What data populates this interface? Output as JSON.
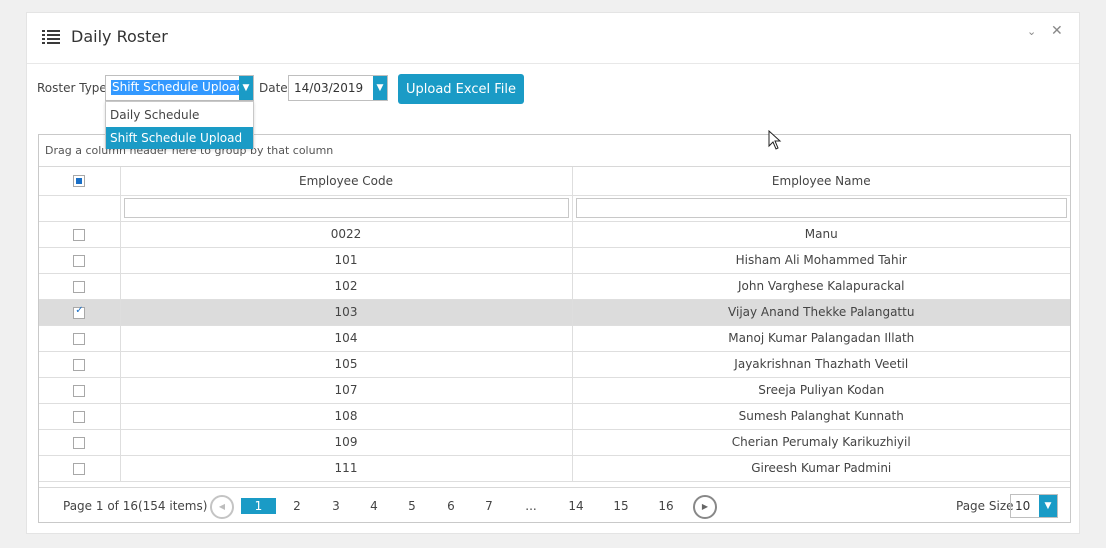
{
  "panel": {
    "title": "Daily Roster",
    "title_icon": "list-icon",
    "collapse_icon": "chevron-down-icon",
    "close_icon": "close-icon",
    "collapse_glyph": "⌄",
    "close_glyph": "✕"
  },
  "toolbar": {
    "roster_type_label": "Roster Type",
    "roster_type_value": "Shift Schedule Upload",
    "date_label": "Date",
    "date_value": "14/03/2019",
    "upload_label": "Upload Excel File",
    "arrow_glyph": "▼"
  },
  "roster_dropdown": {
    "options": [
      "Daily Schedule",
      "Shift Schedule Upload"
    ],
    "selected": "Shift Schedule Upload"
  },
  "grid": {
    "group_hint": "Drag a column header here to group by that column",
    "columns": [
      "Employee Code",
      "Employee Name"
    ],
    "rows": [
      {
        "code": "0022",
        "name": "Manu",
        "checked": false
      },
      {
        "code": "101",
        "name": "Hisham Ali Mohammed Tahir",
        "checked": false
      },
      {
        "code": "102",
        "name": "John Varghese Kalapurackal",
        "checked": false
      },
      {
        "code": "103",
        "name": "Vijay Anand Thekke Palangattu",
        "checked": true
      },
      {
        "code": "104",
        "name": "Manoj Kumar Palangadan Illath",
        "checked": false
      },
      {
        "code": "105",
        "name": "Jayakrishnan Thazhath Veetil",
        "checked": false
      },
      {
        "code": "107",
        "name": "Sreeja Puliyan Kodan",
        "checked": false
      },
      {
        "code": "108",
        "name": "Sumesh Palanghat Kunnath",
        "checked": false
      },
      {
        "code": "109",
        "name": "Cherian Perumaly Karikuzhiyil",
        "checked": false
      },
      {
        "code": "111",
        "name": "Gireesh Kumar Padmini",
        "checked": false
      }
    ]
  },
  "pager": {
    "info": "Page 1 of 16(154 items)",
    "pages": [
      "1",
      "2",
      "3",
      "4",
      "5",
      "6",
      "7",
      "...",
      "14",
      "15",
      "16"
    ],
    "current_page": "1",
    "prev_glyph": "◀",
    "next_glyph": "▶",
    "page_size_label": "Page Size",
    "page_size_value": "10"
  },
  "colors": {
    "accent": "#1a9bc6",
    "selected_row": "#dcdcdc",
    "text_selection": "#3399ff"
  }
}
